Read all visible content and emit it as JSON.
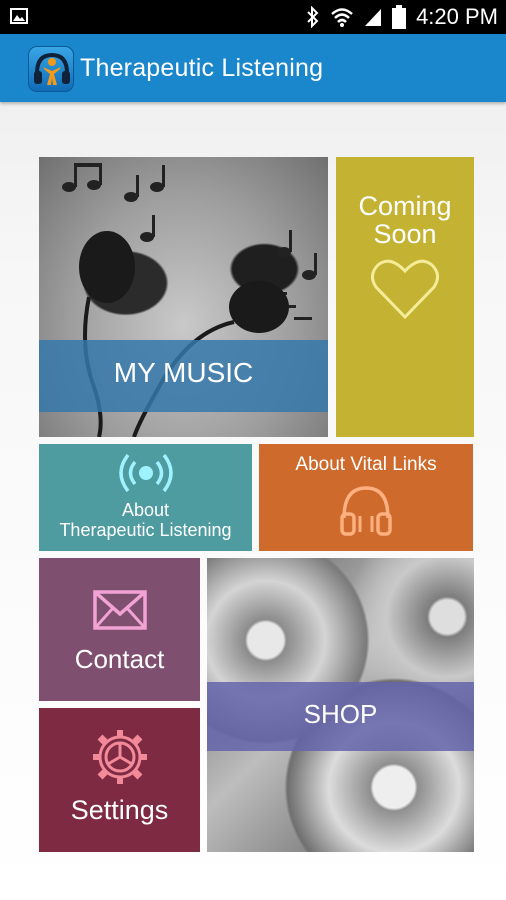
{
  "status_bar": {
    "time": "4:20 PM"
  },
  "app_bar": {
    "title": "Therapeutic Listening",
    "logo_icon": "headphones-person-icon",
    "color": "#1a86cc"
  },
  "tiles": {
    "my_music": {
      "label": "MY MUSIC"
    },
    "coming_soon": {
      "label_line1": "Coming",
      "label_line2": "Soon",
      "icon": "heart-icon",
      "color": "#c4b232"
    },
    "about_therapeutic": {
      "label_line1": "About",
      "label_line2": "Therapeutic Listening",
      "icon": "broadcast-icon",
      "color": "#4e9ba0"
    },
    "about_vital_links": {
      "label": "About Vital Links",
      "icon": "headphones-icon",
      "color": "#cd6a2c"
    },
    "contact": {
      "label": "Contact",
      "icon": "envelope-icon",
      "color": "#7f4f70"
    },
    "settings": {
      "label": "Settings",
      "icon": "gear-icon",
      "color": "#7e2a43"
    },
    "shop": {
      "label": "SHOP"
    }
  }
}
